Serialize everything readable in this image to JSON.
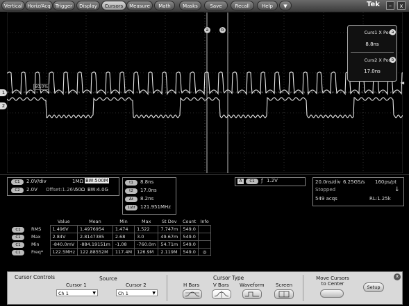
{
  "menu": {
    "items": [
      "Vertical",
      "Horiz/Acq",
      "Trigger",
      "Display",
      "Cursors",
      "Measure",
      "Math",
      "Masks",
      "Save",
      "Recall",
      "Help"
    ],
    "active": "Cursors",
    "dropdown_glyph": "▼",
    "brand": "Tek",
    "minimize_glyph": "–",
    "close_glyph": "x"
  },
  "cursor_readout": {
    "c1_label": "Curs1 X Pos",
    "c1_value": "8.8ns",
    "c1_badge": "a",
    "c2_label": "Curs2 X Pos",
    "c2_value": "17.0ns",
    "c2_badge": "b"
  },
  "graticule": {
    "ch1_marker": "1",
    "ch2_marker": "2",
    "trigger_level_marker": "◄",
    "cursor_a_marker": "a",
    "cursor_b_marker": "b",
    "ref_label": "60.0%"
  },
  "channels": {
    "c1": {
      "chip": "C1",
      "scale": "2.0V/div",
      "impedance": "1MΩ",
      "bw_label": "BW:500M"
    },
    "c2": {
      "chip": "C2",
      "scale": "2.0V",
      "offset": "Offset:1.26V",
      "impedance": "50Ω",
      "bw_label": "BW:4.0G"
    }
  },
  "cursor_values": {
    "t1_chip": "t1",
    "t1": "8.8ns",
    "t2_chip": "t2",
    "t2": "17.0ns",
    "dt_chip": "Δt",
    "dt": "8.2ns",
    "inv_chip": "1/Δt",
    "inv": "121.951MHz"
  },
  "trigger": {
    "mode_chip": "A",
    "source_chip": "C1",
    "slope_glyph": "ƒ",
    "level": "1.2V"
  },
  "acquisition": {
    "timebase": "20.0ns/div",
    "sample_rate": "6.25GS/s",
    "resolution": "160ps/pt",
    "state": "Stopped",
    "acqs": "549 acqs",
    "record_length": "RL:1.25k",
    "arrow_glyph": "↓"
  },
  "measurements": {
    "headers": [
      "Value",
      "Mean",
      "Min",
      "Max",
      "St Dev",
      "Count",
      "Info"
    ],
    "rows": [
      {
        "chip": "C1",
        "name": "RMS",
        "cells": [
          "1.496V",
          "1.4976954",
          "1.474",
          "1.522",
          "7.747m",
          "549.0",
          ""
        ]
      },
      {
        "chip": "C1",
        "name": "Max",
        "cells": [
          "2.84V",
          "2.8147385",
          "2.68",
          "3.0",
          "49.67m",
          "549.0",
          ""
        ]
      },
      {
        "chip": "C1",
        "name": "Min",
        "cells": [
          "-840.0mV",
          "-884.19151m",
          "-1.08",
          "-760.0m",
          "54.71m",
          "549.0",
          ""
        ]
      },
      {
        "chip": "C1",
        "name": "Freq*",
        "cells": [
          "122.5MHz",
          "122.88552M",
          "117.4M",
          "126.9M",
          "2.119M",
          "549.0",
          ""
        ]
      }
    ],
    "info_glyph": "◎"
  },
  "controls": {
    "panel_title": "Cursor Controls",
    "source_label": "Source",
    "cursor1_label": "Cursor 1",
    "cursor1_value": "Ch 1",
    "cursor2_label": "Cursor 2",
    "cursor2_value": "Ch 1",
    "select_arrow": "▼",
    "cursor_type_label": "Cursor Type",
    "type_hbars": "H Bars",
    "type_vbars": "V Bars",
    "type_waveform": "Waveform",
    "type_screen": "Screen",
    "move_center_line1": "Move Cursors",
    "move_center_line2": "to Center",
    "setup_label": "Setup",
    "close_glyph": "x"
  }
}
